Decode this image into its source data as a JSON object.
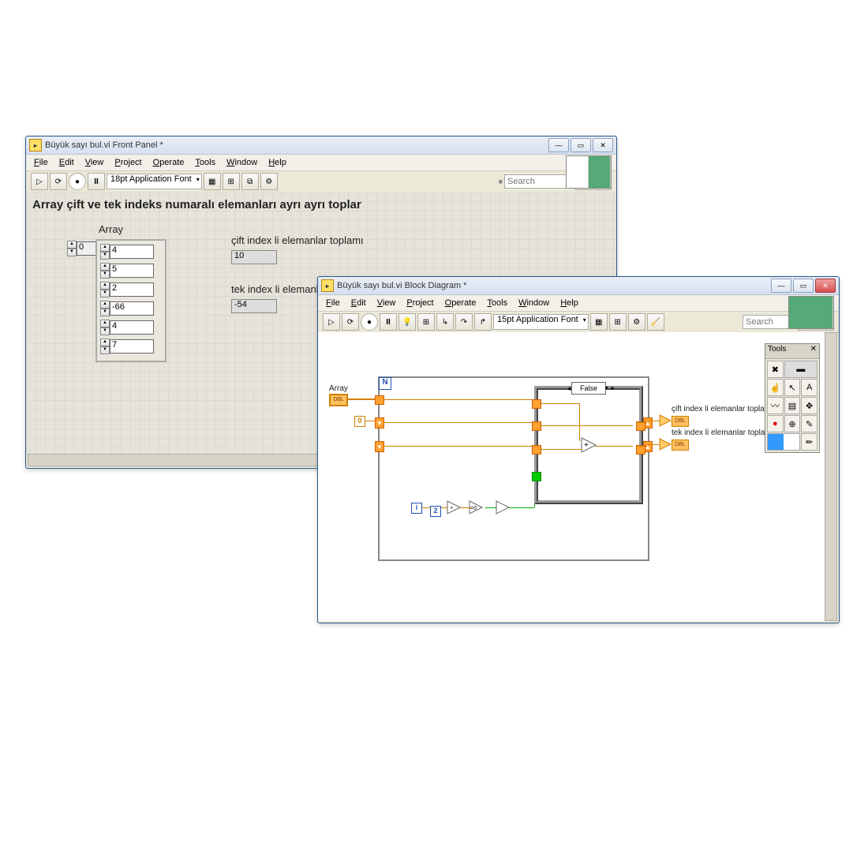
{
  "front_panel": {
    "title": "Büyük sayı bul.vi Front Panel *",
    "menus": [
      "File",
      "Edit",
      "View",
      "Project",
      "Operate",
      "Tools",
      "Window",
      "Help"
    ],
    "font": "18pt Application Font",
    "search_placeholder": "Search",
    "heading": "Array çift ve tek indeks numaralı elemanları ayrı ayrı toplar",
    "array_label": "Array",
    "index_value": "0",
    "array_values": [
      "4",
      "5",
      "2",
      "-66",
      "4",
      "7"
    ],
    "even_label": "çift index li elemanlar toplamı",
    "even_value": "10",
    "odd_label": "tek index li elemanlar toplamı",
    "odd_value": "-54"
  },
  "block_diagram": {
    "title": "Büyük sayı bul.vi Block Diagram *",
    "menus": [
      "File",
      "Edit",
      "View",
      "Project",
      "Operate",
      "Tools",
      "Window",
      "Help"
    ],
    "font": "15pt Application Font",
    "search_placeholder": "Search",
    "array_label": "Array",
    "array_term": "DBL",
    "zero_const": "0",
    "i_const": "i",
    "two_const": "2",
    "n_label": "N",
    "case_value": "False",
    "even_out_label": "çift index li elemanlar toplamı",
    "even_term": "DBL",
    "odd_out_label": "tek index li elemanlar toplamı",
    "odd_term": "DBL",
    "tools_title": "Tools"
  }
}
